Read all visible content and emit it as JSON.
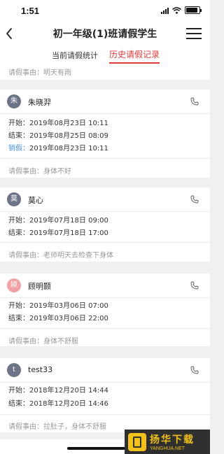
{
  "status_bar": {
    "time": "1:51"
  },
  "header": {
    "title": "初一年级(1)班请假学生"
  },
  "tabs": [
    {
      "label": "当前请假统计",
      "active": false
    },
    {
      "label": "历史请假记录",
      "active": true
    }
  ],
  "partial_reason": "请假事由：明天有雨",
  "records": [
    {
      "avatar": "朱",
      "avatar_color": "#6e7487",
      "name": "朱晓羿",
      "start": {
        "label": "开始：",
        "value": "2019年08月23日 10:11"
      },
      "end": {
        "label": "结束：",
        "value": "2019年08月25日 08:09"
      },
      "cancel": {
        "label": "销假：",
        "value": "2019年08月23日 10:11"
      },
      "reason": "请假事由：身体不好"
    },
    {
      "avatar": "莫",
      "avatar_color": "#6e7487",
      "name": "莫心",
      "start": {
        "label": "开始：",
        "value": "2019年07月18日 09:00"
      },
      "end": {
        "label": "结束：",
        "value": "2019年07月18日 17:00"
      },
      "reason": "请假事由：老师明天去检查下身体"
    },
    {
      "avatar": "颍",
      "avatar_color": "#f0a3a3",
      "name": "顾明颢",
      "start": {
        "label": "开始：",
        "value": "2019年03月06日 07:00"
      },
      "end": {
        "label": "结束：",
        "value": "2019年03月06日 22:00"
      },
      "reason": "请假事由：身体不舒服"
    },
    {
      "avatar": "t",
      "avatar_color": "#6e7487",
      "name": "test33",
      "start": {
        "label": "开始：",
        "value": "2018年12月20日 14:44"
      },
      "end": {
        "label": "结束：",
        "value": "2018年12月20日 14:46"
      },
      "reason": "请假事由：拉肚子，身体不舒服"
    }
  ],
  "watermark": {
    "cn": "扬华下载",
    "en": "YANGHUA.NET"
  },
  "colors": {
    "accent": "#e23b3b",
    "cancel": "#4a90d9",
    "muted": "#999999"
  }
}
